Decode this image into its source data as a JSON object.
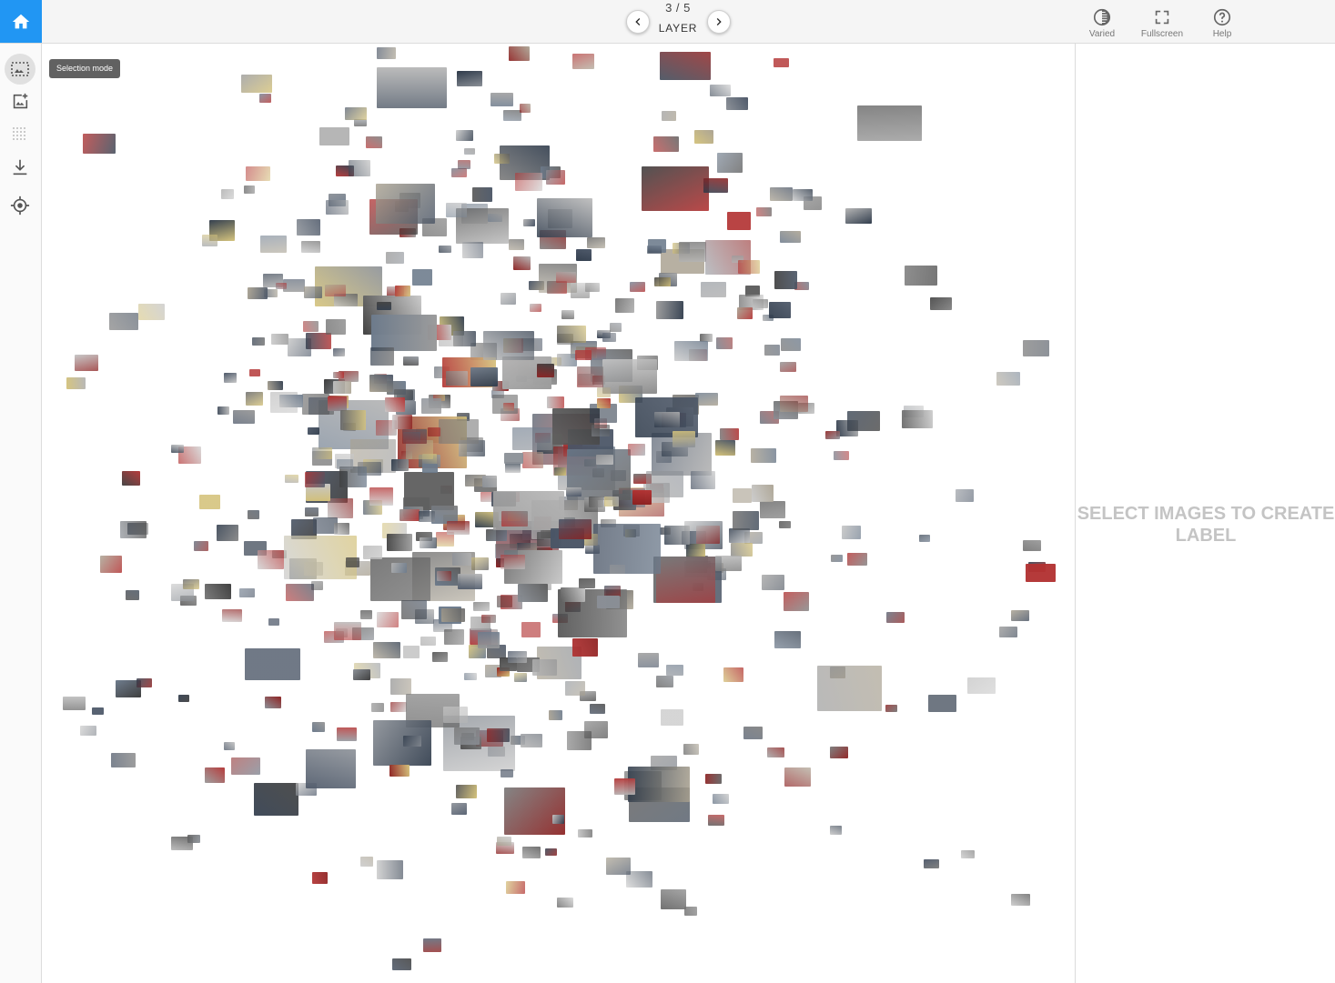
{
  "app": {
    "home_icon": "home-icon",
    "accent_color": "#2196f3"
  },
  "layer_nav": {
    "count": "3 / 5",
    "label": "LAYER",
    "prev_icon": "chevron-left-icon",
    "next_icon": "chevron-right-icon"
  },
  "toolbar": {
    "items": [
      {
        "label": "Varied",
        "icon": "contrast-icon"
      },
      {
        "label": "Fullscreen",
        "icon": "fullscreen-icon"
      },
      {
        "label": "Help",
        "icon": "help-icon"
      }
    ]
  },
  "sidebar": {
    "items": [
      {
        "name": "selection-mode",
        "icon": "selection-mode-icon",
        "active": true
      },
      {
        "name": "add-label",
        "icon": "add-image-icon",
        "active": false
      },
      {
        "name": "grid",
        "icon": "grid-dots-icon",
        "active": false
      },
      {
        "name": "download",
        "icon": "download-icon",
        "active": false
      },
      {
        "name": "locate",
        "icon": "target-icon",
        "active": false
      }
    ],
    "tooltip": "Selection mode"
  },
  "canvas": {
    "content": "scatter of car image thumbnails"
  },
  "right_panel": {
    "message": "SELECT IMAGES TO CREATE LABEL"
  }
}
